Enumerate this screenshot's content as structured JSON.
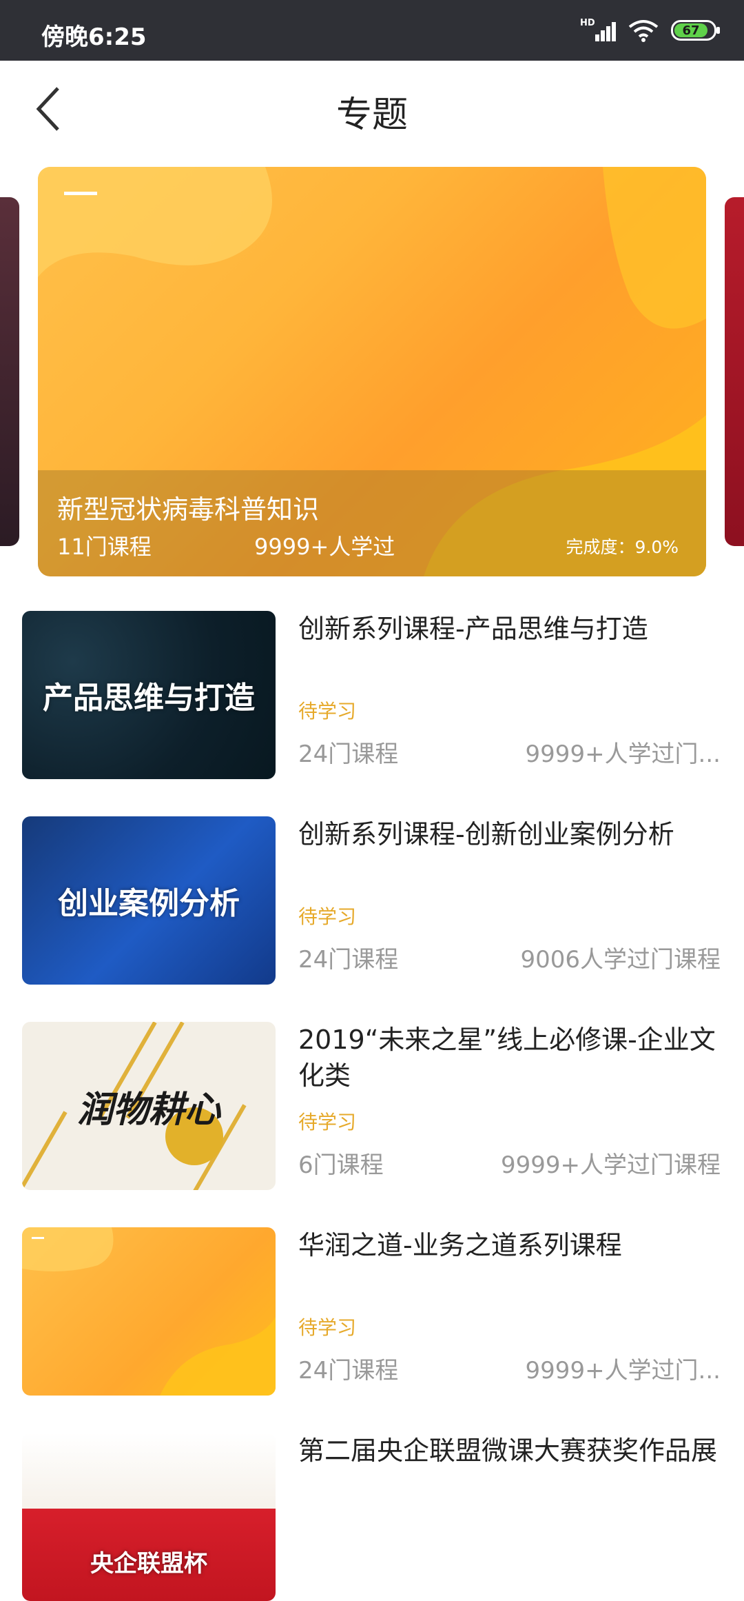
{
  "status_bar": {
    "time": "傍晚6:25",
    "network": "HD",
    "battery": "67"
  },
  "header": {
    "title": "专题"
  },
  "banner": {
    "title": "新型冠状病毒科普知识",
    "courses": "11门课程",
    "learners": "9999+人学过",
    "progress": "完成度：9.0%"
  },
  "list": [
    {
      "thumb_text": "产品思维与打造",
      "title": "创新系列课程-产品思维与打造",
      "status": "待学习",
      "courses": "24门课程",
      "learners": "9999+人学过门..."
    },
    {
      "thumb_text": "创业案例分析",
      "title": "创新系列课程-创新创业案例分析",
      "status": "待学习",
      "courses": "24门课程",
      "learners": "9006人学过门课程"
    },
    {
      "thumb_text": "润物耕心",
      "title": "2019“未来之星”线上必修课-企业文化类",
      "status": "待学习",
      "courses": "6门课程",
      "learners": "9999+人学过门课程"
    },
    {
      "thumb_text": "",
      "title": "华润之道-业务之道系列课程",
      "status": "待学习",
      "courses": "24门课程",
      "learners": "9999+人学过门..."
    },
    {
      "thumb_text": "央企联盟杯",
      "title": "第二届央企联盟微课大赛获奖作品展",
      "status": "",
      "courses": "",
      "learners": ""
    }
  ],
  "colors": {
    "accent_status": "#e6a92a",
    "banner_orange": "#ffb53a",
    "statusbar_bg": "#2f3036"
  },
  "icons": {
    "back": "chevron-left-icon",
    "wifi": "wifi-icon",
    "signal": "signal-icon",
    "battery": "battery-icon"
  }
}
